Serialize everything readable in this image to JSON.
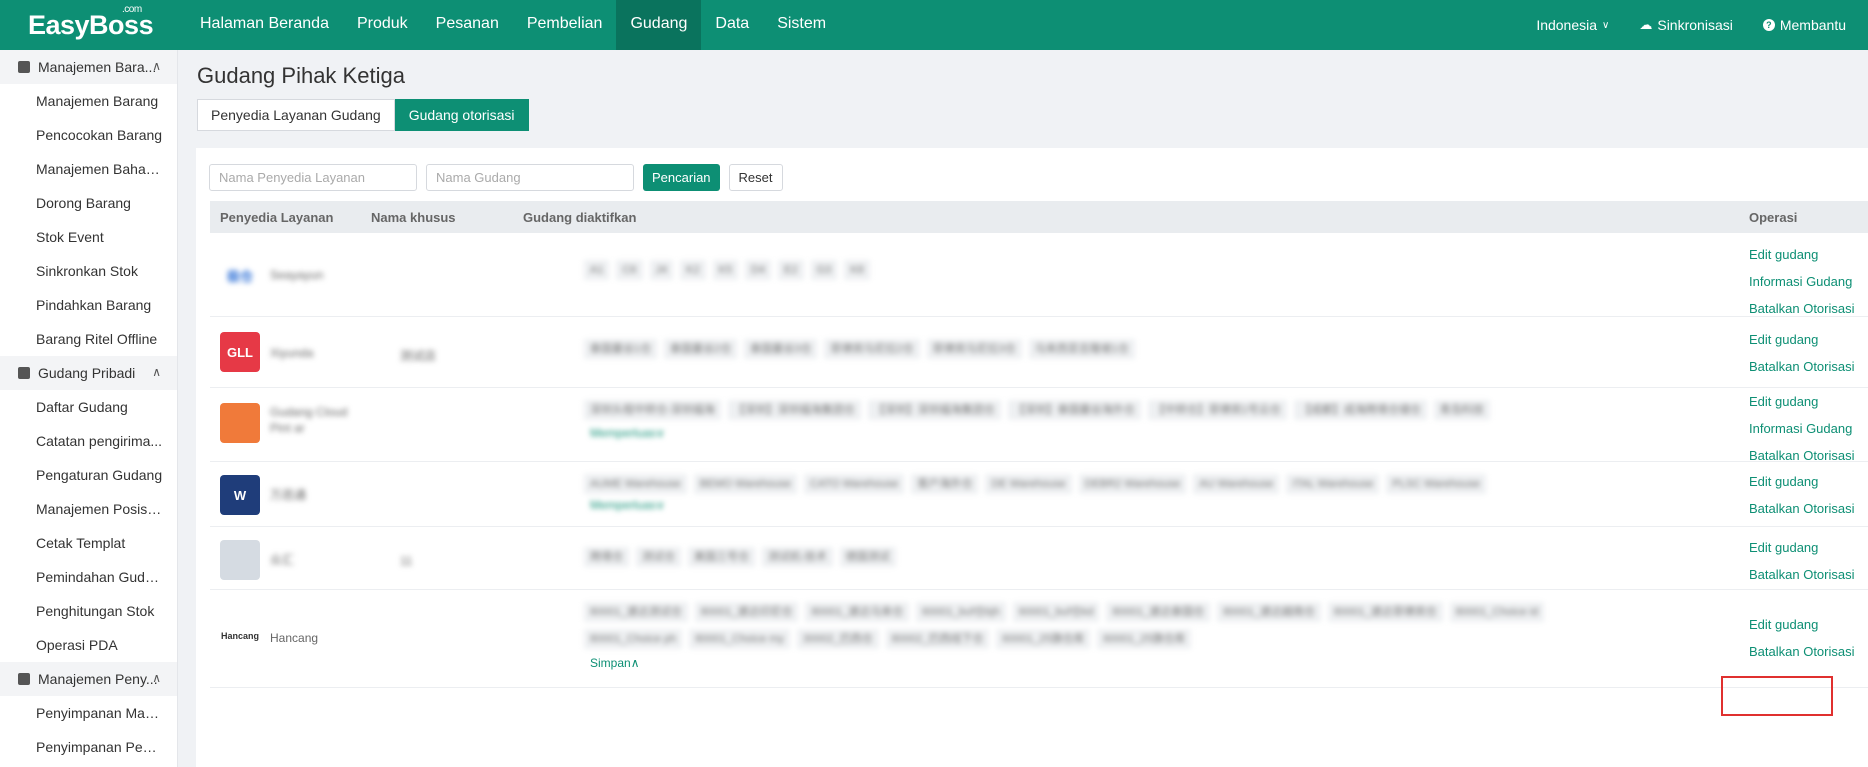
{
  "brand": {
    "name": "EasyBoss",
    "suffix": ".com"
  },
  "nav": [
    {
      "label": "Halaman Beranda"
    },
    {
      "label": "Produk"
    },
    {
      "label": "Pesanan"
    },
    {
      "label": "Pembelian"
    },
    {
      "label": "Gudang",
      "active": true
    },
    {
      "label": "Data"
    },
    {
      "label": "Sistem"
    }
  ],
  "top_right": {
    "language": "Indonesia",
    "sync": "Sinkronisasi",
    "help": "Membantu"
  },
  "sidebar": {
    "groups": [
      {
        "title": "Manajemen Bara...",
        "items": [
          "Manajemen Barang",
          "Pencocokan Barang",
          "Manajemen Bahan ...",
          "Dorong Barang",
          "Stok Event",
          "Sinkronkan Stok",
          "Pindahkan Barang",
          "Barang Ritel Offline"
        ]
      },
      {
        "title": "Gudang Pribadi",
        "items": [
          "Daftar Gudang",
          "Catatan pengirima...",
          "Pengaturan Gudang",
          "Manajemen Posisi ...",
          "Cetak Templat",
          "Pemindahan Gudang",
          "Penghitungan Stok",
          "Operasi PDA"
        ]
      },
      {
        "title": "Manajemen Peny...",
        "items": [
          "Penyimpanan Man...",
          "Penyimpanan Peng..."
        ]
      }
    ]
  },
  "page": {
    "title": "Gudang Pihak Ketiga",
    "tabs": [
      {
        "label": "Penyedia Layanan Gudang"
      },
      {
        "label": "Gudang otorisasi",
        "active": true
      }
    ],
    "filters": {
      "provider_placeholder": "Nama Penyedia Layanan",
      "warehouse_placeholder": "Nama Gudang",
      "search_label": "Pencarian",
      "reset_label": "Reset"
    },
    "table": {
      "headers": {
        "provider": "Penyedia Layanan",
        "custom": "Nama khusus",
        "warehouses": "Gudang diaktifkan",
        "ops": "Operasi"
      },
      "rows": [
        {
          "provider": "Seayayun",
          "custom": "",
          "logo_color": "#2c6fd6",
          "logo_text": "极仓",
          "warehouses": [
            "A1",
            "C6",
            "J4",
            "K2",
            "K5",
            "D4",
            "E2",
            "G3",
            "K8"
          ],
          "expand": "",
          "ops": [
            "Edit gudang",
            "Informasi Gudang",
            "Batalkan Otorisasi"
          ]
        },
        {
          "provider": "Xiyunda",
          "custom": "测试店",
          "logo_color": "#e63946",
          "logo_text": "GLL",
          "warehouses": [
            "泰国曼谷1仓",
            "泰国曼谷2仓",
            "泰国曼谷3仓",
            "菲律宾马尼拉2仓",
            "菲律宾马尼拉3仓",
            "马来西亚吉隆坡1仓"
          ],
          "expand": "",
          "ops": [
            "Edit gudang",
            "Batalkan Otorisasi"
          ]
        },
        {
          "provider": "Gudang Cloud Pint ar",
          "custom": "",
          "logo_color": "#f07a3a",
          "logo_text": "",
          "warehouses": [
            "深圳头程中转仓-深圳福海",
            "【深圳】深圳福海集团仓",
            "【深圳】深圳福海集团仓",
            "【深圳】泰国曼谷海外仓",
            "【中转仓】菲律宾1号云仓",
            "【成都】成海跨境仓储仓",
            "青岛科技"
          ],
          "expand": "Memperluas",
          "ops": [
            "Edit gudang",
            "Informasi Gudang",
            "Batalkan Otorisasi"
          ]
        },
        {
          "provider": "万邑通",
          "custom": "",
          "logo_color": "#1f3d7a",
          "logo_text": "W",
          "warehouses": [
            "AUME Warehouse",
            "BEMO Warehouse",
            "CATO Warehouse",
            "客户海外仓",
            "DE Warehouse",
            "DEBR2 Warehouse",
            "AU Warehouse",
            "ITAL Warehouse",
            "PLSC Warehouse"
          ],
          "expand": "Memperluas",
          "ops": [
            "Edit gudang",
            "Batalkan Otorisasi"
          ]
        },
        {
          "provider": "众汇",
          "custom": "11",
          "logo_color": "#d5dbe2",
          "logo_text": "",
          "warehouses": [
            "跨境仓",
            "测试仓",
            "美国三号仓",
            "测试机-技术",
            "德国测试"
          ],
          "expand": "",
          "ops": [
            "Edit gudang",
            "Batalkan Otorisasi"
          ]
        },
        {
          "provider": "Hancang",
          "custom": "",
          "logo_color": "#ffffff",
          "logo_text": "Hancang",
          "warehouses": [
            "80001_速达测试仓",
            "80001_速达印尼仓",
            "80001_速达马来仓",
            "60001_buf仓bjh",
            "60001_buf仓kd",
            "80001_速达泰国仓",
            "80001_速达越南仓",
            "80001_速达菲律宾仓",
            "80001_Choice id",
            "80001_Choice ph",
            "80001_Choice my",
            "30002_巴西仓",
            "80002_巴西线下仓",
            "60001_25旗仓库",
            "60001_25旗仓库"
          ],
          "expand": "Simpan",
          "ops": [
            "Edit gudang",
            "Batalkan Otorisasi"
          ]
        }
      ]
    }
  }
}
